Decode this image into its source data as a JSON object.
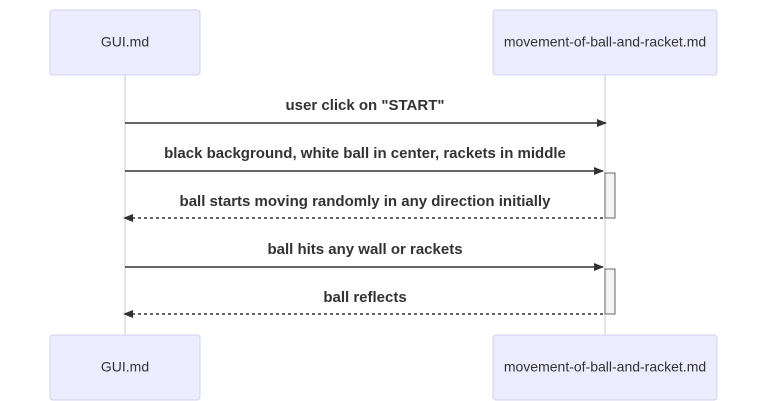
{
  "diagram": {
    "participants": [
      {
        "id": "gui",
        "label": "GUI.md"
      },
      {
        "id": "movement",
        "label": "movement-of-ball-and-racket.md"
      }
    ],
    "messages": [
      {
        "from": "gui",
        "to": "movement",
        "text": "user click on \"START\"",
        "style": "solid"
      },
      {
        "from": "gui",
        "to": "movement",
        "text": "black background, white ball in center, rackets in middle",
        "style": "solid"
      },
      {
        "from": "movement",
        "to": "gui",
        "text": "ball starts moving randomly in any direction initially",
        "style": "dashed"
      },
      {
        "from": "gui",
        "to": "movement",
        "text": "ball hits any wall or rackets",
        "style": "solid"
      },
      {
        "from": "movement",
        "to": "gui",
        "text": "ball reflects",
        "style": "dashed"
      }
    ],
    "colors": {
      "actor_fill": "#ECECFF",
      "actor_border": "#d4d0ef",
      "line": "#333333",
      "text": "#333333"
    }
  }
}
